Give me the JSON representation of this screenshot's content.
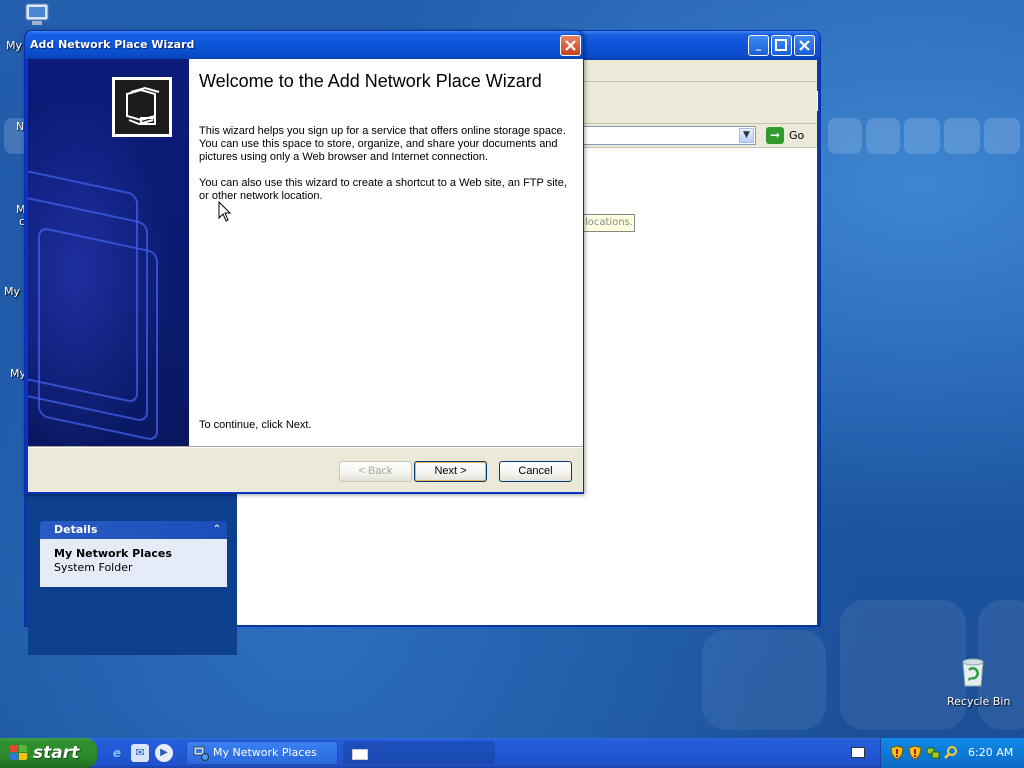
{
  "desktop": {
    "icons": [
      {
        "label": "My",
        "name": "my-documents"
      },
      {
        "label": "N",
        "name": "network-icon-partial"
      },
      {
        "label": "M",
        "name": "my-computer-partial"
      },
      {
        "label": "c",
        "name": "partial-label"
      },
      {
        "label": "My I",
        "name": "my-internet-partial"
      },
      {
        "label": "My",
        "name": "my-music-partial"
      }
    ],
    "recycle_bin_label": "Recycle Bin"
  },
  "explorer": {
    "go_label": "Go",
    "tooltip_fragment": "locations.",
    "details": {
      "header": "Details",
      "title": "My Network Places",
      "subtitle": "System Folder"
    }
  },
  "wizard": {
    "title": "Add Network Place Wizard",
    "heading": "Welcome to the Add Network Place Wizard",
    "paragraph1": "This wizard helps you sign up for a service that offers online storage space. You can use this space to store, organize, and share your documents and pictures using only a Web browser and Internet connection.",
    "paragraph2": "You can also use this wizard to create a shortcut to a Web site, an FTP site, or other network location.",
    "continue_text": "To continue, click Next.",
    "back_label": "< Back",
    "next_label": "Next >",
    "cancel_label": "Cancel"
  },
  "taskbar": {
    "start_label": "start",
    "task_items": [
      {
        "label": "My Network Places"
      },
      {
        "label": ""
      }
    ],
    "clock": "6:20 AM"
  },
  "colors": {
    "titlebar_blue": "#0c56dc",
    "close_red": "#c7401e",
    "start_green": "#2f8f2f",
    "tray_blue": "#0c7ad9"
  }
}
